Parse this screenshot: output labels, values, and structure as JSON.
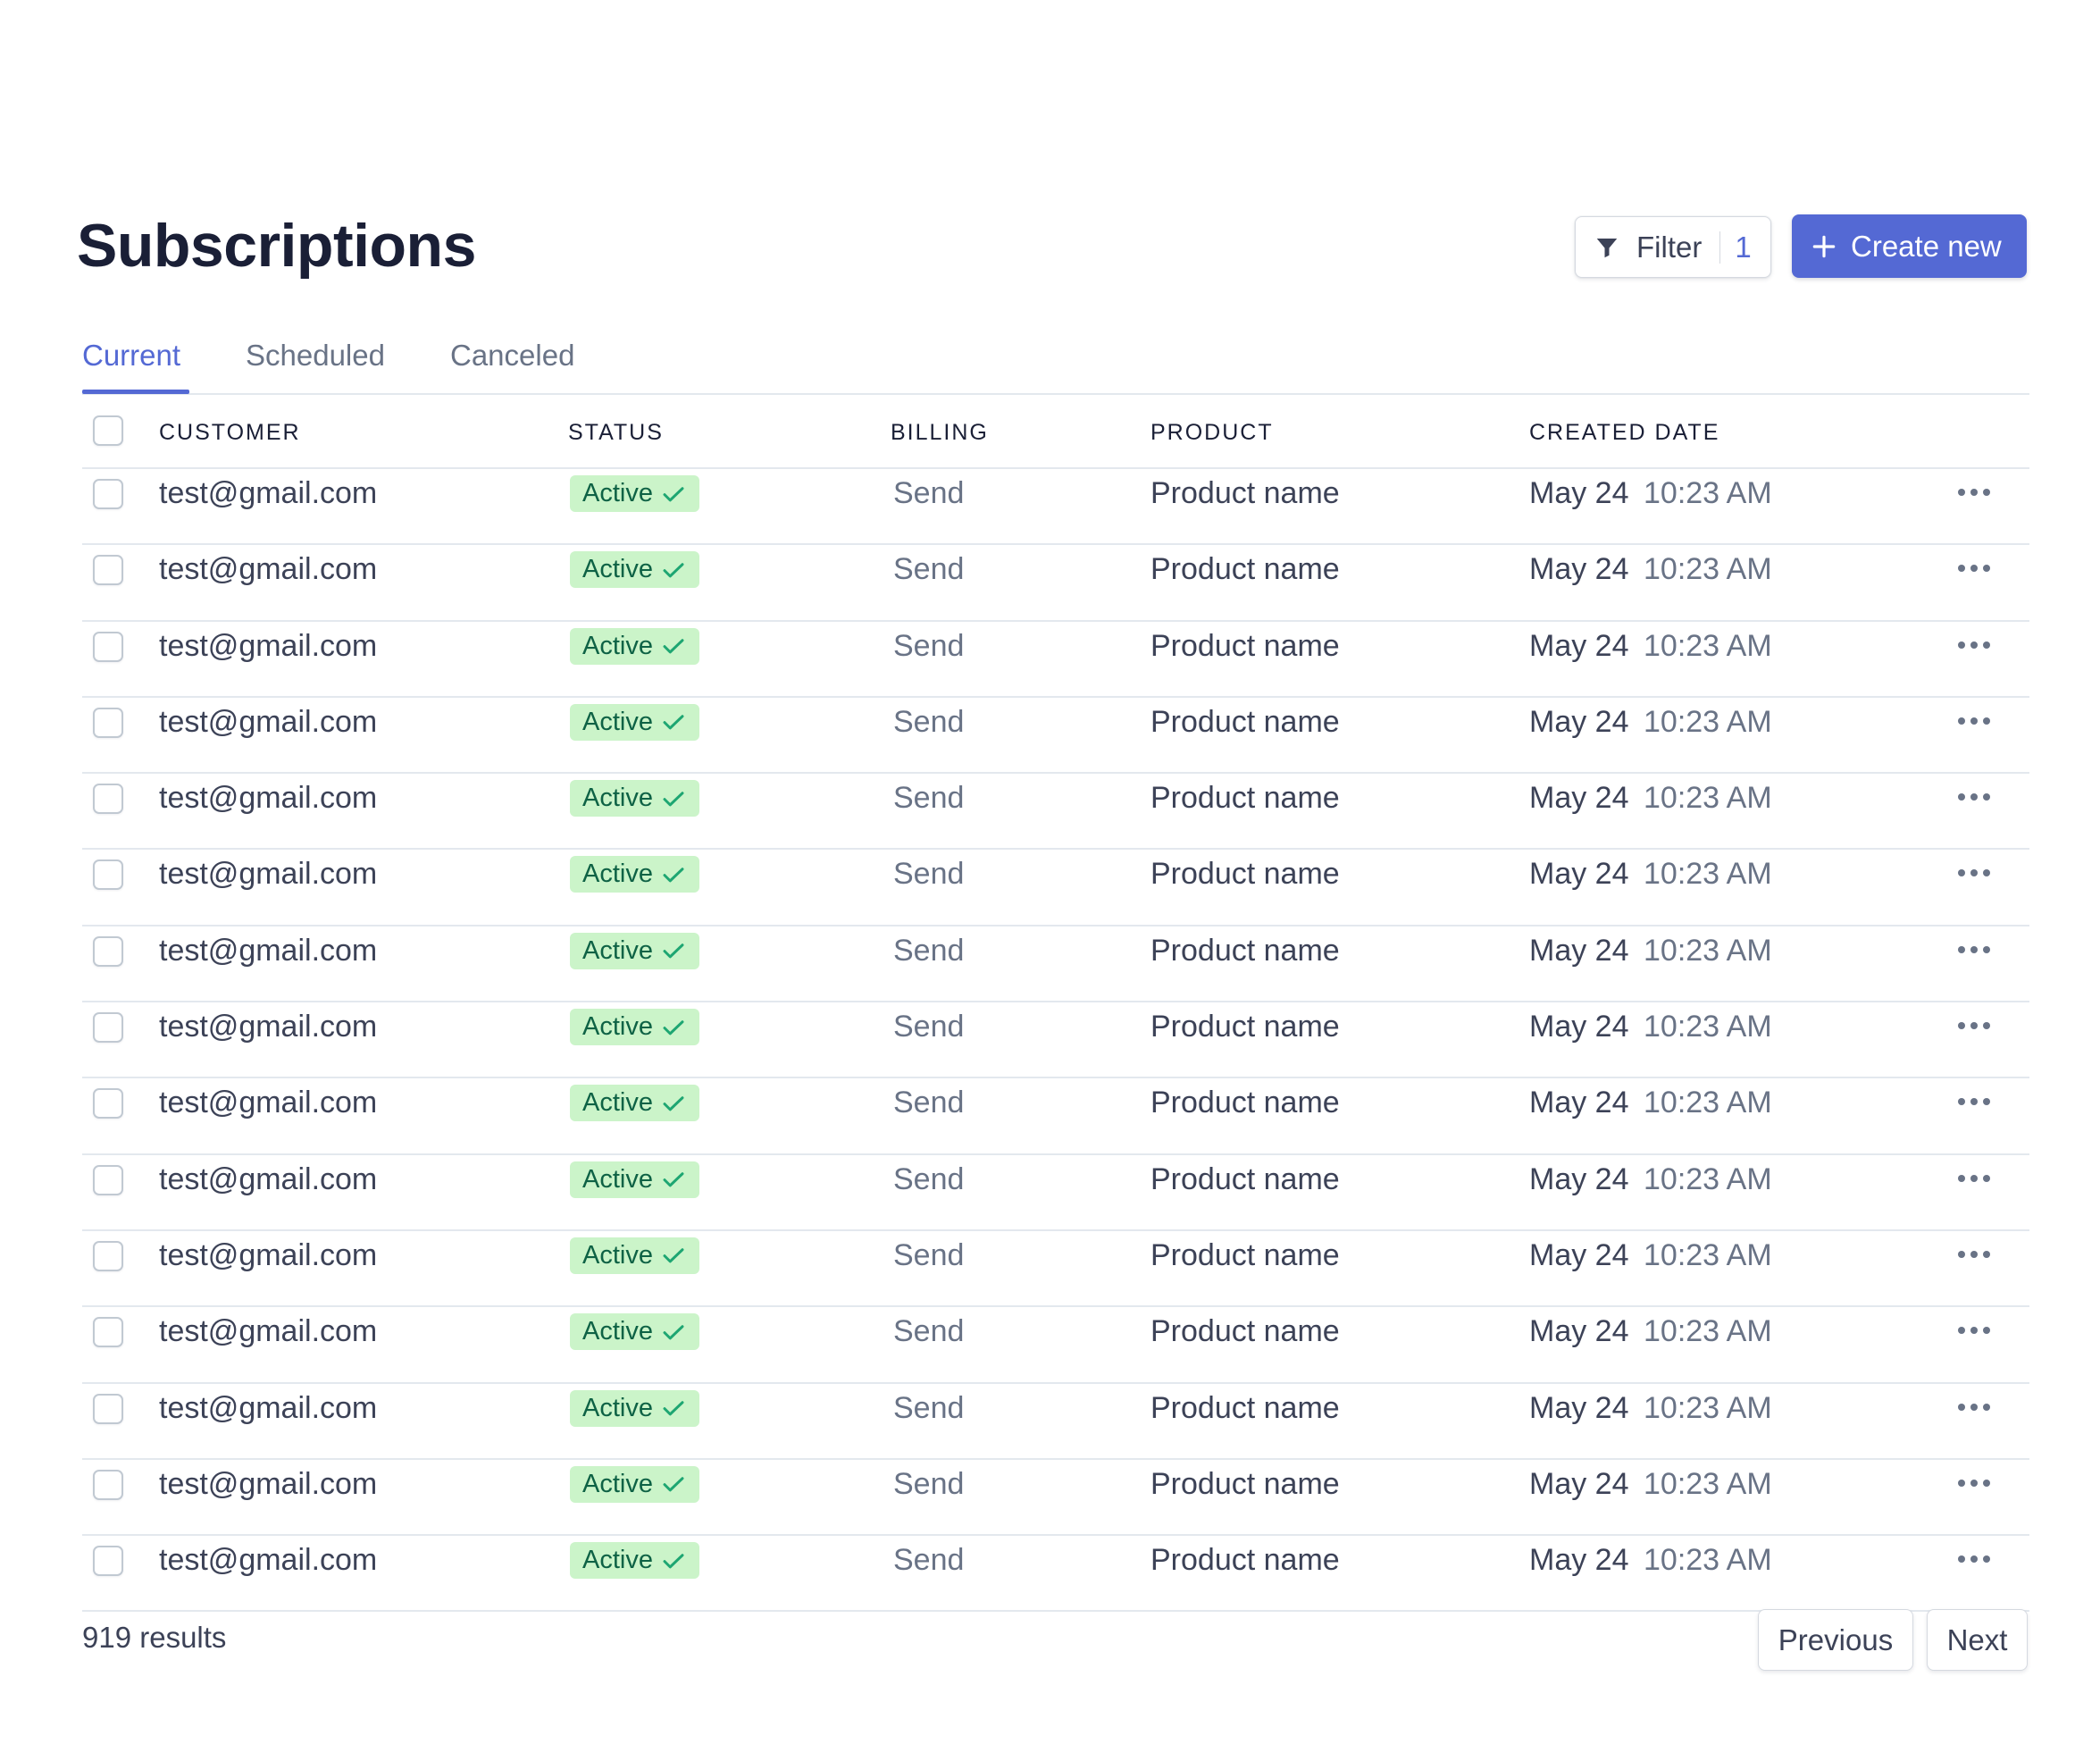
{
  "page": {
    "title": "Subscriptions"
  },
  "toolbar": {
    "filter_label": "Filter",
    "filter_count": "1",
    "create_label": "Create new"
  },
  "tabs": [
    {
      "label": "Current",
      "active": true
    },
    {
      "label": "Scheduled",
      "active": false
    },
    {
      "label": "Canceled",
      "active": false
    }
  ],
  "table": {
    "headers": [
      "CUSTOMER",
      "STATUS",
      "BILLING",
      "PRODUCT",
      "CREATED DATE"
    ],
    "rows": [
      {
        "customer": "test@gmail.com",
        "status": "Active",
        "billing": "Send",
        "product": "Product name",
        "date": "May 24",
        "time": "10:23 AM"
      },
      {
        "customer": "test@gmail.com",
        "status": "Active",
        "billing": "Send",
        "product": "Product name",
        "date": "May 24",
        "time": "10:23 AM"
      },
      {
        "customer": "test@gmail.com",
        "status": "Active",
        "billing": "Send",
        "product": "Product name",
        "date": "May 24",
        "time": "10:23 AM"
      },
      {
        "customer": "test@gmail.com",
        "status": "Active",
        "billing": "Send",
        "product": "Product name",
        "date": "May 24",
        "time": "10:23 AM"
      },
      {
        "customer": "test@gmail.com",
        "status": "Active",
        "billing": "Send",
        "product": "Product name",
        "date": "May 24",
        "time": "10:23 AM"
      },
      {
        "customer": "test@gmail.com",
        "status": "Active",
        "billing": "Send",
        "product": "Product name",
        "date": "May 24",
        "time": "10:23 AM"
      },
      {
        "customer": "test@gmail.com",
        "status": "Active",
        "billing": "Send",
        "product": "Product name",
        "date": "May 24",
        "time": "10:23 AM"
      },
      {
        "customer": "test@gmail.com",
        "status": "Active",
        "billing": "Send",
        "product": "Product name",
        "date": "May 24",
        "time": "10:23 AM"
      },
      {
        "customer": "test@gmail.com",
        "status": "Active",
        "billing": "Send",
        "product": "Product name",
        "date": "May 24",
        "time": "10:23 AM"
      },
      {
        "customer": "test@gmail.com",
        "status": "Active",
        "billing": "Send",
        "product": "Product name",
        "date": "May 24",
        "time": "10:23 AM"
      },
      {
        "customer": "test@gmail.com",
        "status": "Active",
        "billing": "Send",
        "product": "Product name",
        "date": "May 24",
        "time": "10:23 AM"
      },
      {
        "customer": "test@gmail.com",
        "status": "Active",
        "billing": "Send",
        "product": "Product name",
        "date": "May 24",
        "time": "10:23 AM"
      },
      {
        "customer": "test@gmail.com",
        "status": "Active",
        "billing": "Send",
        "product": "Product name",
        "date": "May 24",
        "time": "10:23 AM"
      },
      {
        "customer": "test@gmail.com",
        "status": "Active",
        "billing": "Send",
        "product": "Product name",
        "date": "May 24",
        "time": "10:23 AM"
      },
      {
        "customer": "test@gmail.com",
        "status": "Active",
        "billing": "Send",
        "product": "Product name",
        "date": "May 24",
        "time": "10:23 AM"
      }
    ]
  },
  "footer": {
    "results": "919 results",
    "previous_label": "Previous",
    "next_label": "Next"
  },
  "icons": {
    "filter": "filter-icon",
    "plus": "plus-icon",
    "check": "check-icon",
    "more": "more-horizontal-icon"
  },
  "colors": {
    "accent": "#5469d4",
    "badge_bg": "#cbf4c9",
    "badge_text": "#0e6245",
    "muted": "#697386",
    "text": "#3c4257",
    "heading": "#1a1f36",
    "border": "#e3e8ee"
  }
}
